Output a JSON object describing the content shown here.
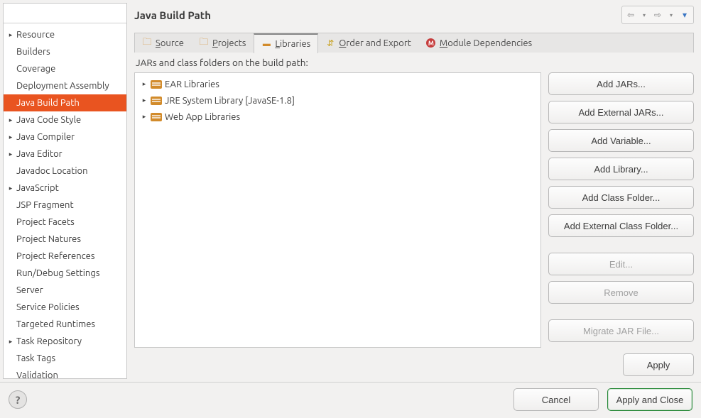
{
  "filter": {
    "placeholder": ""
  },
  "sidebar": {
    "items": [
      {
        "label": "Resource",
        "expandable": true
      },
      {
        "label": "Builders",
        "expandable": false
      },
      {
        "label": "Coverage",
        "expandable": false
      },
      {
        "label": "Deployment Assembly",
        "expandable": false
      },
      {
        "label": "Java Build Path",
        "expandable": false,
        "selected": true
      },
      {
        "label": "Java Code Style",
        "expandable": true
      },
      {
        "label": "Java Compiler",
        "expandable": true
      },
      {
        "label": "Java Editor",
        "expandable": true
      },
      {
        "label": "Javadoc Location",
        "expandable": false
      },
      {
        "label": "JavaScript",
        "expandable": true
      },
      {
        "label": "JSP Fragment",
        "expandable": false
      },
      {
        "label": "Project Facets",
        "expandable": false
      },
      {
        "label": "Project Natures",
        "expandable": false
      },
      {
        "label": "Project References",
        "expandable": false
      },
      {
        "label": "Run/Debug Settings",
        "expandable": false
      },
      {
        "label": "Server",
        "expandable": false
      },
      {
        "label": "Service Policies",
        "expandable": false
      },
      {
        "label": "Targeted Runtimes",
        "expandable": false
      },
      {
        "label": "Task Repository",
        "expandable": true
      },
      {
        "label": "Task Tags",
        "expandable": false
      },
      {
        "label": "Validation",
        "expandable": false
      }
    ]
  },
  "header": {
    "title": "Java Build Path"
  },
  "tabs": [
    {
      "icon": "folder",
      "pre": "",
      "mnemonic": "S",
      "post": "ource"
    },
    {
      "icon": "folder",
      "pre": "",
      "mnemonic": "P",
      "post": "rojects"
    },
    {
      "icon": "lib",
      "pre": "",
      "mnemonic": "L",
      "post": "ibraries",
      "active": true
    },
    {
      "icon": "order",
      "pre": "",
      "mnemonic": "O",
      "post": "rder and Export"
    },
    {
      "icon": "mod",
      "pre": "",
      "mnemonic": "M",
      "post": "odule Dependencies"
    }
  ],
  "description": "JARs and class folders on the build path:",
  "libraries": [
    {
      "label": "EAR Libraries"
    },
    {
      "label": "JRE System Library [JavaSE-1.8]"
    },
    {
      "label": "Web App Libraries"
    }
  ],
  "buttons": {
    "add_jars": "Add JARs...",
    "add_ext_jars": "Add External JARs...",
    "add_variable": "Add Variable...",
    "add_library": "Add Library...",
    "add_class_folder": "Add Class Folder...",
    "add_ext_class_folder": "Add External Class Folder...",
    "edit": "Edit...",
    "remove": "Remove",
    "migrate": "Migrate JAR File...",
    "apply": "Apply"
  },
  "footer": {
    "cancel": "Cancel",
    "apply_close": "Apply and Close"
  }
}
